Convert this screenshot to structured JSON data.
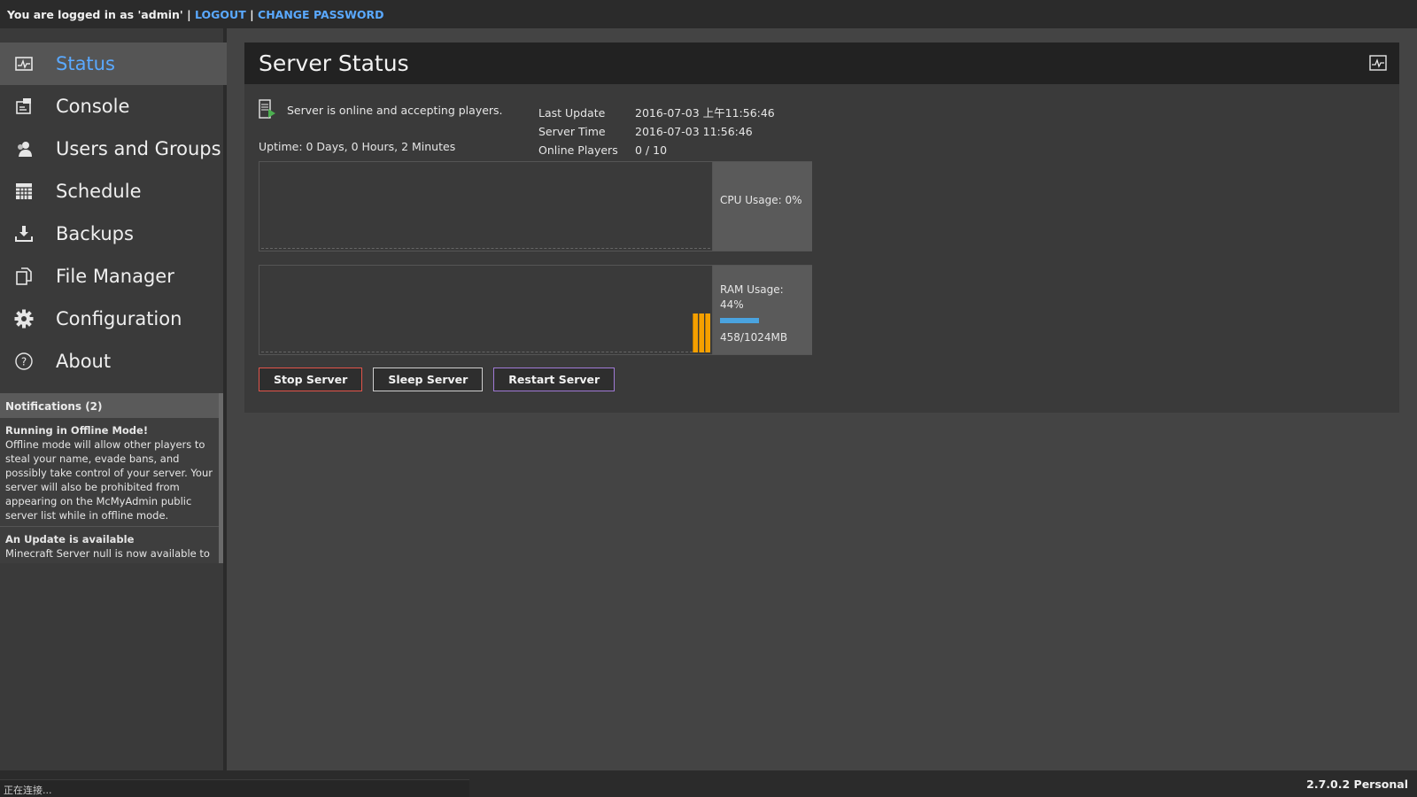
{
  "topbar": {
    "login_text": "You are logged in as 'admin' |",
    "logout": "LOGOUT",
    "separator": "|",
    "change_password": "CHANGE PASSWORD"
  },
  "nav": {
    "items": [
      {
        "label": "Status",
        "icon": "status-monitor-icon",
        "active": true
      },
      {
        "label": "Console",
        "icon": "console-icon"
      },
      {
        "label": "Users and Groups",
        "icon": "users-icon"
      },
      {
        "label": "Schedule",
        "icon": "calendar-icon"
      },
      {
        "label": "Backups",
        "icon": "download-icon"
      },
      {
        "label": "File Manager",
        "icon": "files-icon"
      },
      {
        "label": "Configuration",
        "icon": "gear-icon"
      },
      {
        "label": "About",
        "icon": "help-icon"
      }
    ]
  },
  "notifications": {
    "header": "Notifications (2)",
    "items": [
      {
        "title": "Running in Offline Mode!",
        "body": "Offline mode will allow other players to steal your name, evade bans, and possibly take control of your server. Your server will also be prohibited from appearing on the McMyAdmin public server list while in offline mode."
      },
      {
        "title": "An Update is available",
        "body": "Minecraft Server null is now available to install."
      }
    ]
  },
  "panel": {
    "title": "Server Status",
    "status_message": "Server is online and accepting players.",
    "uptime": "Uptime: 0 Days, 0 Hours, 2 Minutes",
    "info": [
      {
        "key": "Last Update",
        "value": "2016-07-03 上午11:56:46"
      },
      {
        "key": "Server Time",
        "value": "2016-07-03 11:56:46"
      },
      {
        "key": "Online Players",
        "value": "0 / 10"
      }
    ],
    "cpu_label": "CPU Usage: 0%",
    "ram_label": "RAM Usage:",
    "ram_percent": "44%",
    "ram_percent_value": 0.44,
    "ram_detail": "458/1024MB",
    "buttons": {
      "stop": "Stop Server",
      "sleep": "Sleep Server",
      "restart": "Restart Server"
    }
  },
  "footer": {
    "connection": "正在连接...",
    "version": "2.7.0.2 Personal"
  },
  "colors": {
    "accent": "#5aa9ff",
    "ram_bar": "#4aa3df",
    "ram_graph": "#f5a000"
  }
}
